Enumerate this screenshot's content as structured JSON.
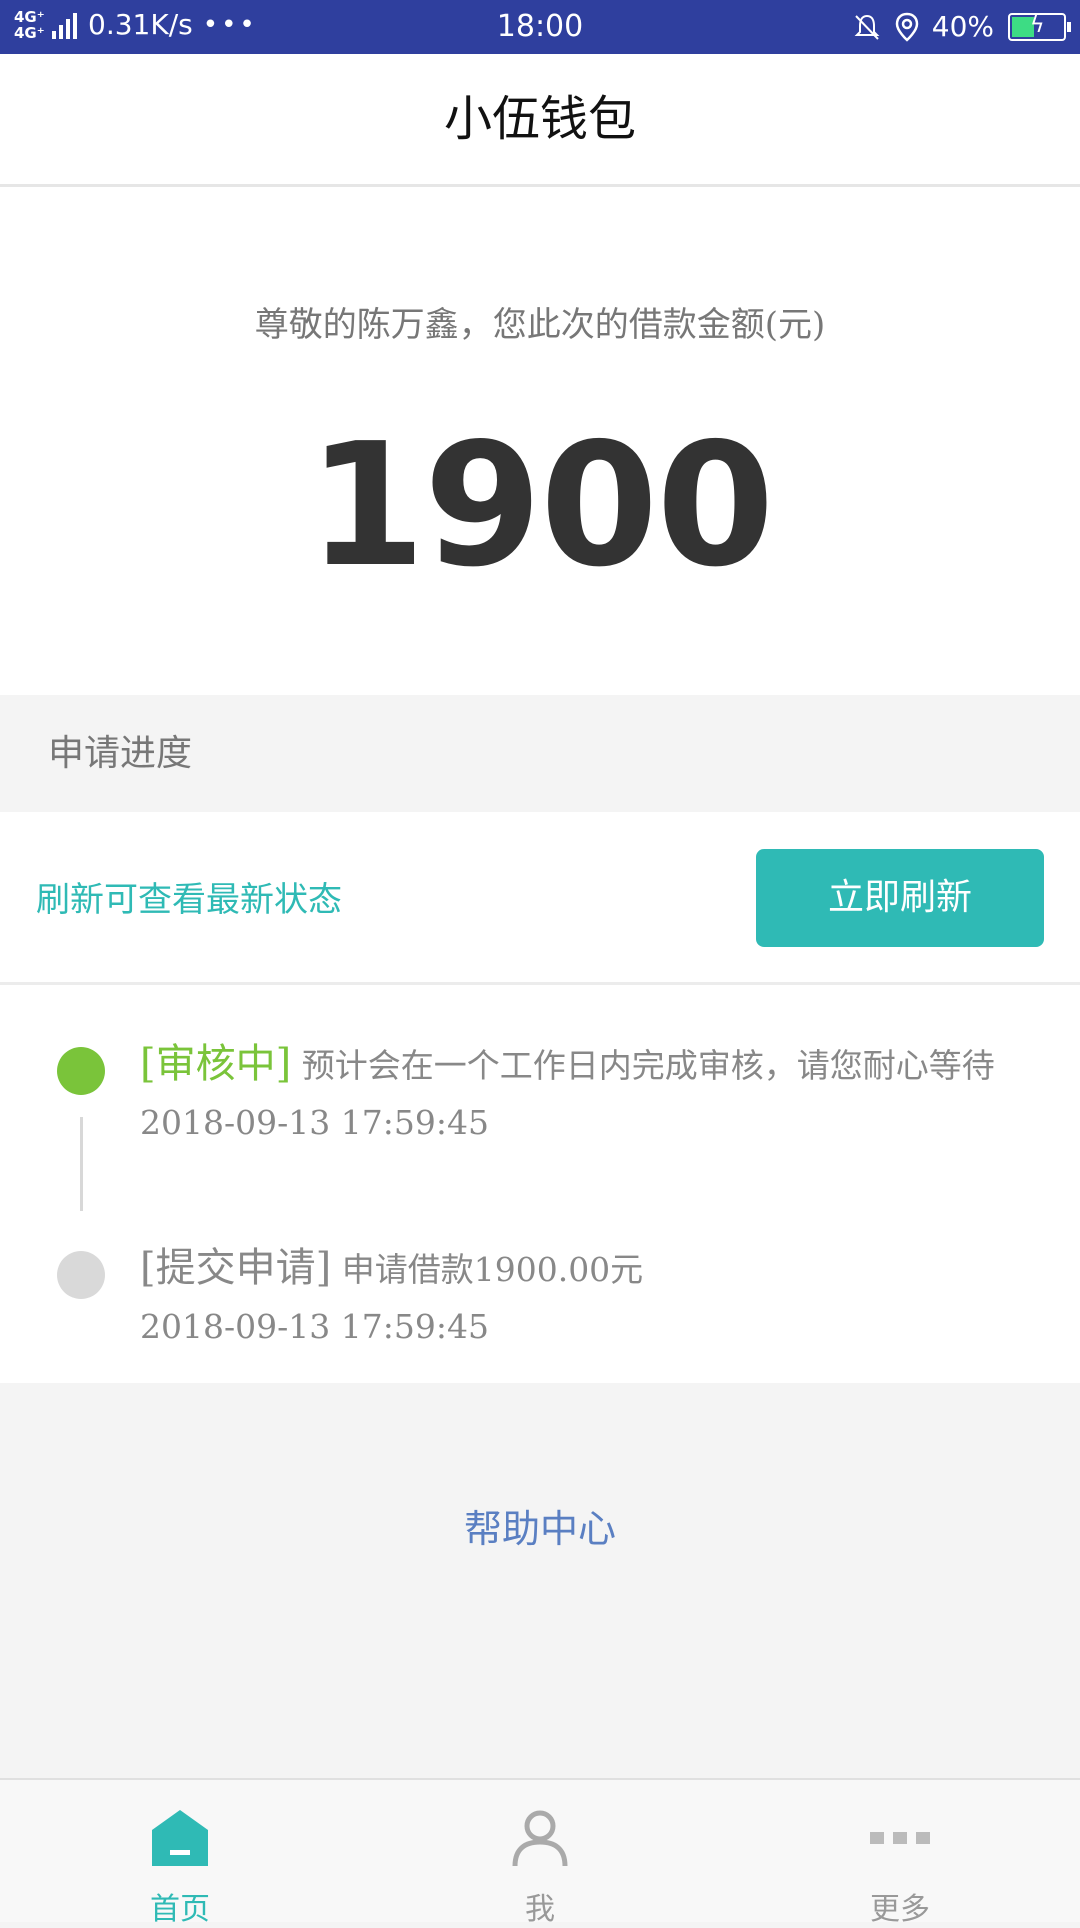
{
  "status_bar": {
    "network": "4G⁺ 4G⁺",
    "speed": "0.31K/s",
    "more": "•••",
    "time": "18:00",
    "battery": "40%"
  },
  "header": {
    "title": "小伍钱包"
  },
  "loan": {
    "greeting": "尊敬的陈万鑫，您此次的借款金额(元)",
    "amount": "1900"
  },
  "progress": {
    "title": "申请进度",
    "refresh_hint": "刷新可查看最新状态",
    "refresh_button": "立即刷新",
    "items": [
      {
        "tag": "[审核中]",
        "text": "预计会在一个工作日内完成审核，请您耐心等待",
        "time": "2018-09-13 17:59:45",
        "status": "active"
      },
      {
        "tag": "[提交申请]",
        "text": "申请借款1900.00元",
        "time": "2018-09-13 17:59:45",
        "status": "done"
      }
    ]
  },
  "help_center": "帮助中心",
  "bottom_nav": [
    {
      "label": "首页",
      "icon": "home-icon",
      "active": true
    },
    {
      "label": "我",
      "icon": "person-icon",
      "active": false
    },
    {
      "label": "更多",
      "icon": "more-icon",
      "active": false
    }
  ],
  "colors": {
    "status_bar": "#2f3f9e",
    "accent": "#2fbab5",
    "active_green": "#7ac43a",
    "help_link": "#5a7fc2"
  }
}
